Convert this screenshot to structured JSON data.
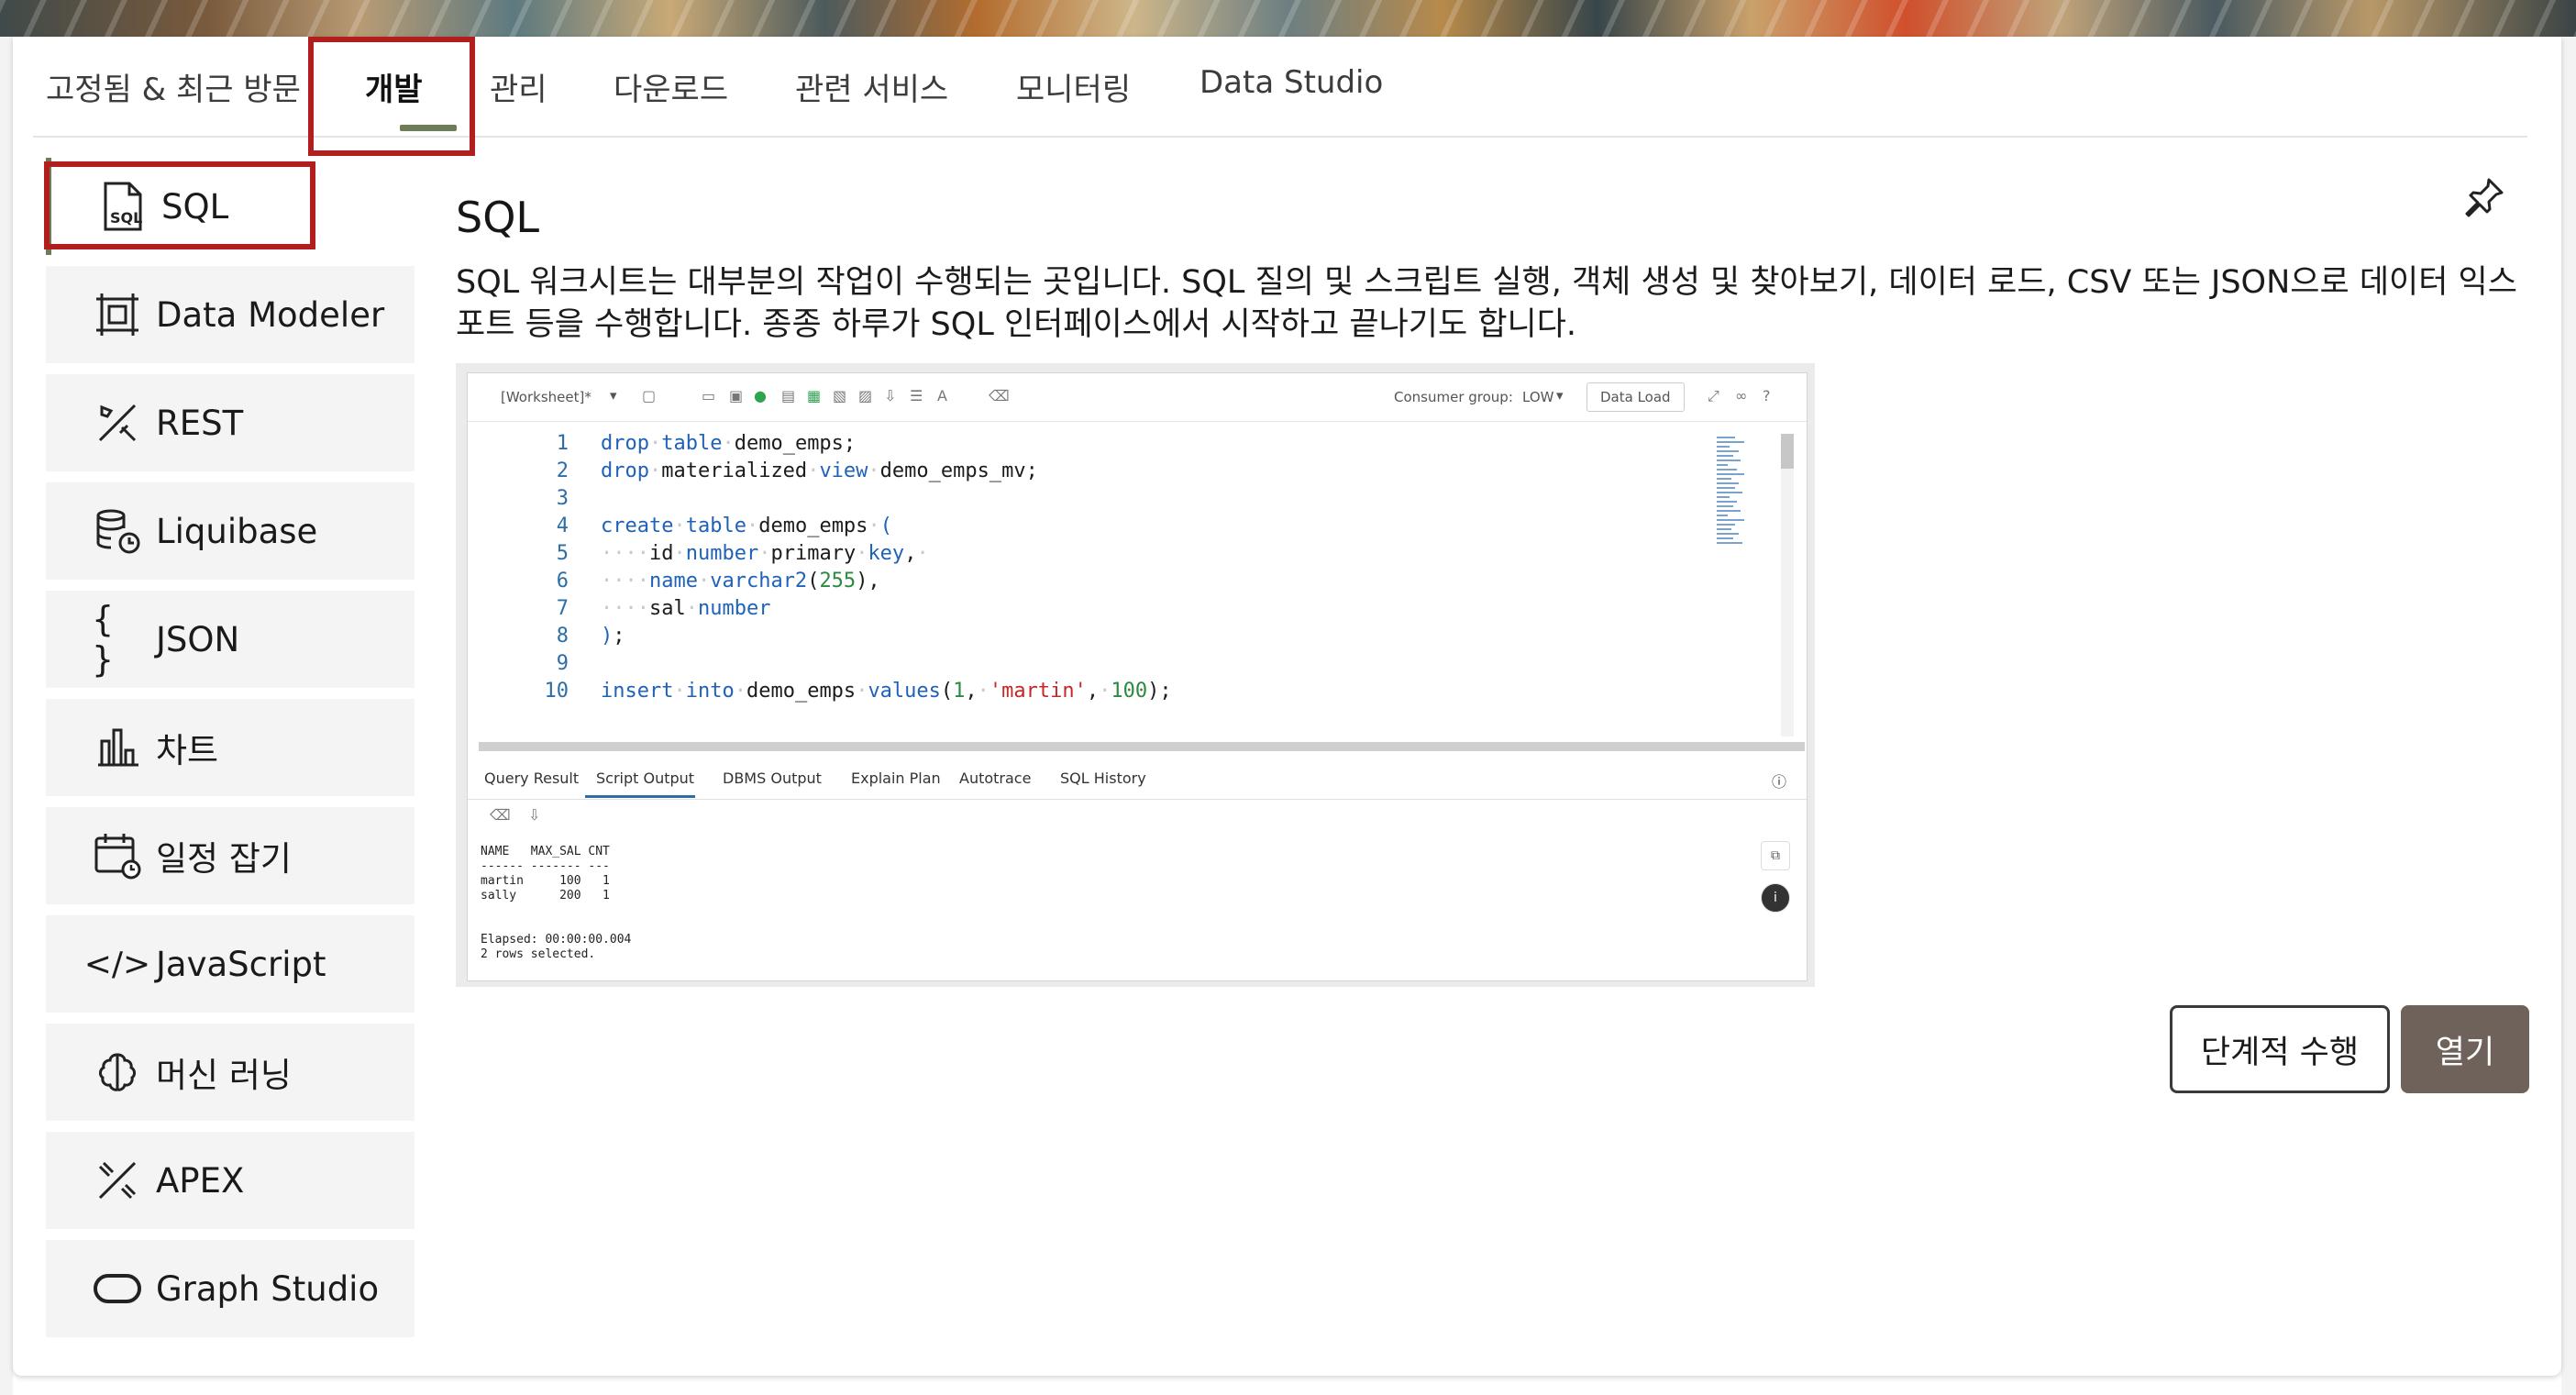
{
  "tabs": [
    {
      "label": "고정됨 & 최근 방문"
    },
    {
      "label": "개발",
      "active": true
    },
    {
      "label": "관리"
    },
    {
      "label": "다운로드"
    },
    {
      "label": "관련 서비스"
    },
    {
      "label": "모니터링"
    },
    {
      "label": "Data Studio"
    }
  ],
  "sidebar": {
    "items": [
      {
        "label": "SQL",
        "icon": "sql-file-icon",
        "active": true
      },
      {
        "label": "Data Modeler",
        "icon": "data-modeler-icon"
      },
      {
        "label": "REST",
        "icon": "rest-tools-icon"
      },
      {
        "label": "Liquibase",
        "icon": "liquibase-icon"
      },
      {
        "label": "JSON",
        "icon": "json-braces-icon"
      },
      {
        "label": "차트",
        "icon": "chart-icon"
      },
      {
        "label": "일정 잡기",
        "icon": "calendar-icon"
      },
      {
        "label": "JavaScript",
        "icon": "javascript-icon"
      },
      {
        "label": "머신 러닝",
        "icon": "machine-learning-icon"
      },
      {
        "label": "APEX",
        "icon": "apex-icon"
      },
      {
        "label": "Graph Studio",
        "icon": "graph-studio-icon"
      }
    ]
  },
  "detail": {
    "title": "SQL",
    "description": "SQL 워크시트는 대부분의 작업이 수행되는 곳입니다. SQL 질의 및 스크립트 실행, 객체 생성 및 찾아보기, 데이터 로드, CSV 또는 JSON으로 데이터 익스포트 등을 수행합니다. 종종 하루가 SQL 인터페이스에서 시작하고 끝나기도 합니다."
  },
  "preview": {
    "worksheet_label": "[Worksheet]*",
    "consumer_group_label": "Consumer group:",
    "consumer_group_value": "LOW",
    "data_load_label": "Data Load",
    "tabs": [
      "Query Result",
      "Script Output",
      "DBMS Output",
      "Explain Plan",
      "Autotrace",
      "SQL History"
    ],
    "output": "NAME   MAX_SAL CNT\n------ ------- ---\nmartin     100   1\nsally      200   1\n\n\nElapsed: 00:00:00.004\n2 rows selected."
  },
  "buttons": {
    "tour": "단계적 수행",
    "open": "열기"
  },
  "colors": {
    "accent": "#6c7d58",
    "highlight": "#b21e1e",
    "primary_button": "#6e625a"
  }
}
